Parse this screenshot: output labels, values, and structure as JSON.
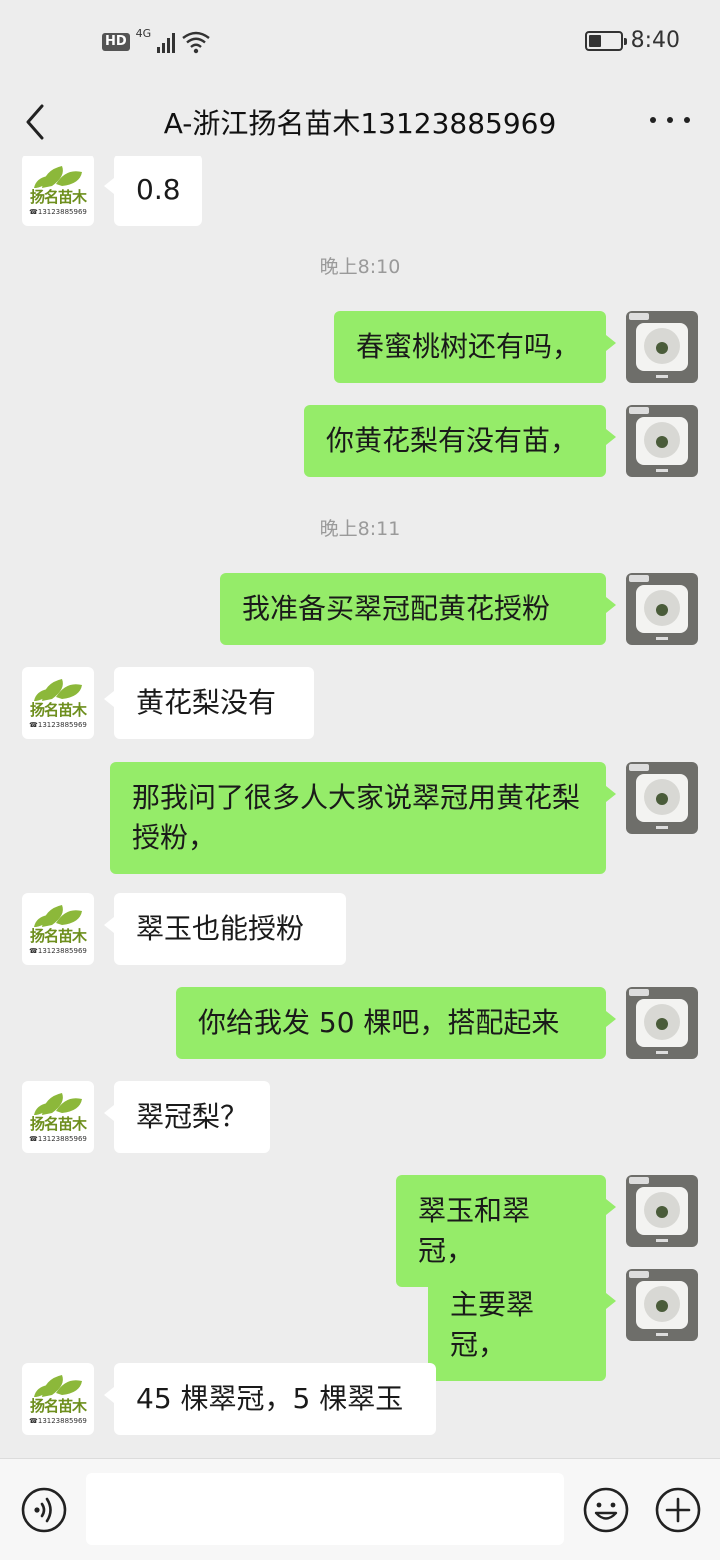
{
  "status_bar": {
    "hd": "HD",
    "network": "4G",
    "time": "8:40",
    "battery_level": 0.4,
    "icons": [
      "signal-icon",
      "wifi-icon",
      "battery-icon"
    ]
  },
  "header": {
    "title": "A-浙江扬名苗木13123885969",
    "icons": [
      "back-arrow-icon",
      "more-icon"
    ]
  },
  "avatars": {
    "contact": {
      "brand": "扬名苗木",
      "phone": "13123885969",
      "colors": {
        "leaf": "#8cb83a",
        "text": "#6e8f1e"
      }
    },
    "self": {
      "type": "qr-card-icon"
    }
  },
  "messages": [
    {
      "side": "left",
      "text": "0.8"
    },
    {
      "type": "time",
      "text": "晚上8:10"
    },
    {
      "side": "right",
      "text": "春蜜桃树还有吗，"
    },
    {
      "side": "right",
      "text": "你黄花梨有没有苗，"
    },
    {
      "type": "time",
      "text": "晚上8:11"
    },
    {
      "side": "right",
      "text": "我准备买翠冠配黄花授粉"
    },
    {
      "side": "left",
      "text": "黄花梨没有"
    },
    {
      "side": "right",
      "text": "那我问了很多人大家说翠冠用黄花梨授粉，"
    },
    {
      "side": "left",
      "text": "翠玉也能授粉"
    },
    {
      "side": "right",
      "text": "你给我发 50 棵吧，搭配起来"
    },
    {
      "side": "left",
      "text": "翠冠梨？"
    },
    {
      "side": "right",
      "text": "翠玉和翠冠，"
    },
    {
      "side": "right",
      "text": "主要翠冠，"
    },
    {
      "side": "left",
      "text": "45 棵翠冠，5 棵翠玉"
    }
  ],
  "input_bar": {
    "placeholder": "",
    "icons": [
      "voice-icon",
      "emoji-icon",
      "plus-icon"
    ]
  },
  "colors": {
    "background": "#ededed",
    "bubble_self": "#95ec69",
    "bubble_other": "#ffffff",
    "timestamp": "#9a9a9a"
  }
}
